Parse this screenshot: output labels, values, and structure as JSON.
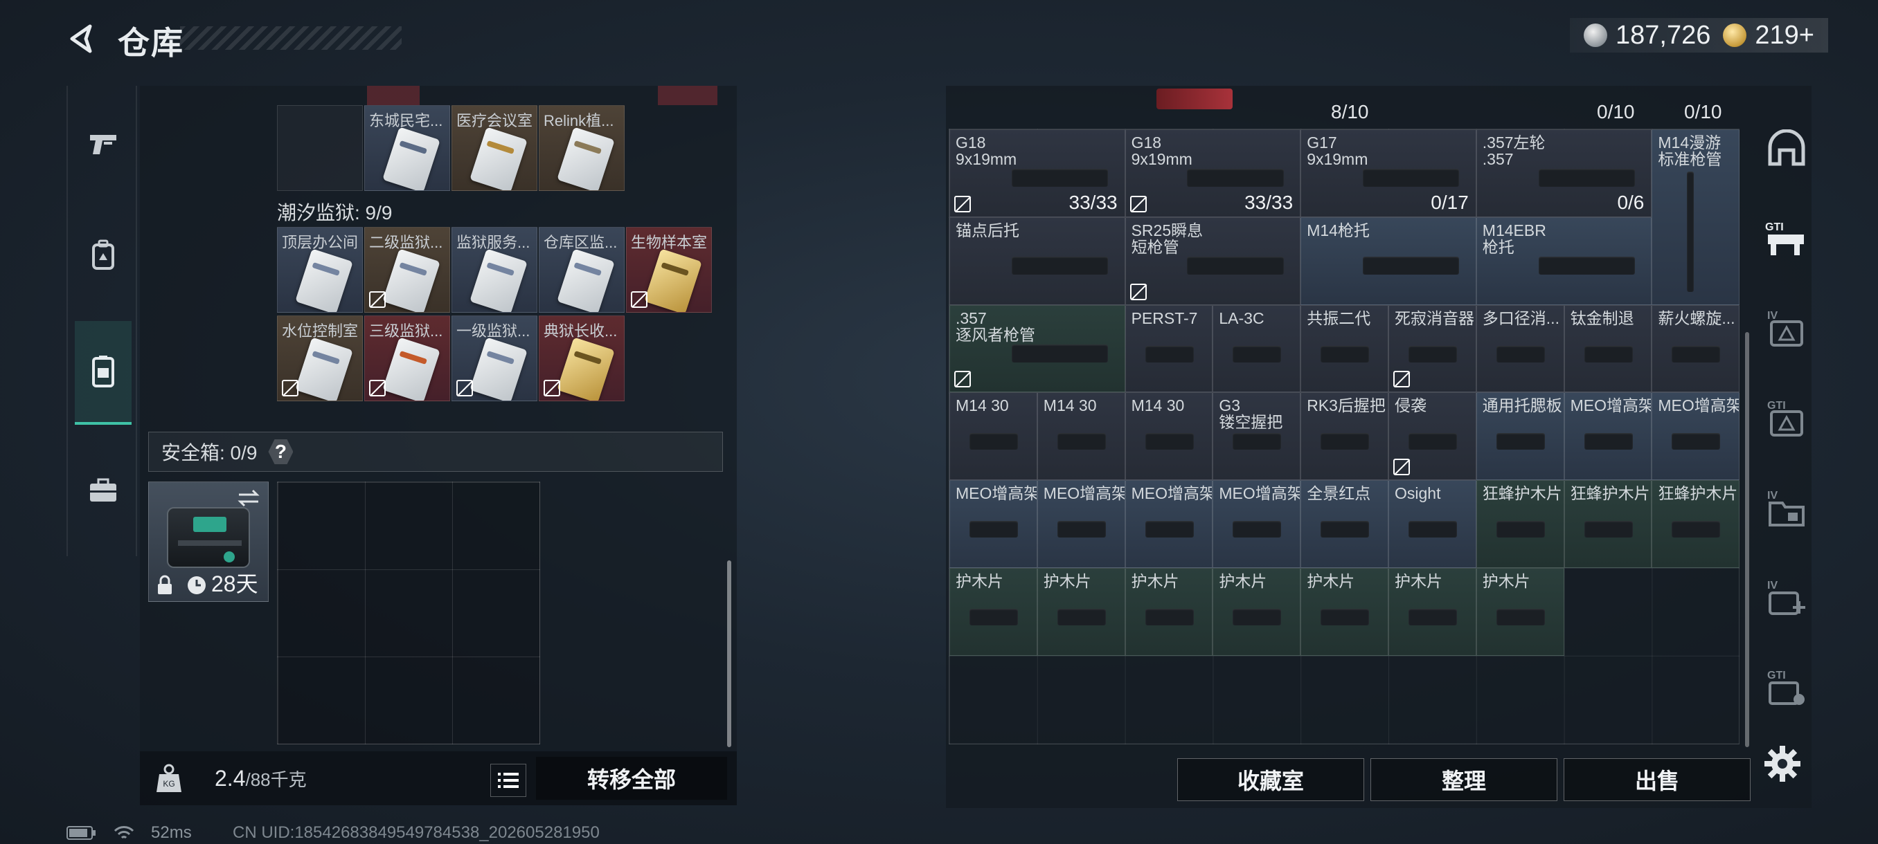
{
  "header": {
    "title": "仓库",
    "currency": [
      {
        "icon": "silver-coin-icon",
        "value": "187,726"
      },
      {
        "icon": "gold-coin-icon",
        "value": "219+"
      }
    ]
  },
  "left_nav": [
    {
      "icon": "gun-icon"
    },
    {
      "icon": "backpack-icon"
    },
    {
      "icon": "storage-locker-icon",
      "active": true
    },
    {
      "icon": "toolbox-icon"
    }
  ],
  "left_panel": {
    "cards_top_row": [
      {
        "label": "",
        "color": "dark"
      },
      {
        "label": "东城民宅...",
        "color": "blue"
      },
      {
        "label": "医疗会议室",
        "color": "brown"
      },
      {
        "label": "Relink植...",
        "color": "brown"
      }
    ],
    "prison_header": "潮汐监狱: 9/9",
    "prison_cards": [
      {
        "label": "顶层办公间",
        "color": "blue",
        "gold": false,
        "nodrop": false
      },
      {
        "label": "二级监狱...",
        "color": "brown",
        "gold": false,
        "nodrop": true
      },
      {
        "label": "监狱服务...",
        "color": "blue",
        "gold": false,
        "nodrop": false
      },
      {
        "label": "仓库区监...",
        "color": "blue",
        "gold": false,
        "nodrop": false
      },
      {
        "label": "生物样本室",
        "color": "red",
        "gold": true,
        "nodrop": true
      },
      {
        "label": "水位控制室",
        "color": "brown",
        "gold": false,
        "nodrop": true
      },
      {
        "label": "三级监狱...",
        "color": "red",
        "gold": false,
        "nodrop": true
      },
      {
        "label": "一级监狱...",
        "color": "blue",
        "gold": false,
        "nodrop": true
      },
      {
        "label": "典狱长收...",
        "color": "red",
        "gold": true,
        "nodrop": true
      }
    ],
    "safebox_label": "安全箱: 0/9",
    "safebox_help": "?",
    "safebox_item_time": "28天",
    "weight_value": "2.4",
    "weight_max": "/88千克",
    "transfer_all": "转移全部"
  },
  "right_panel": {
    "top_counts": [
      "8/10",
      "0/10",
      "0/10"
    ],
    "items": [
      {
        "name": "G18\n9x19mm",
        "count": "33/33",
        "color": "rd",
        "col": 0,
        "row": 0,
        "w": 2,
        "nodrop": true
      },
      {
        "name": "G18\n9x19mm",
        "count": "33/33",
        "color": "rd",
        "col": 2,
        "row": 0,
        "w": 2,
        "nodrop": true
      },
      {
        "name": "G17\n9x19mm",
        "count": "0/17",
        "color": "rd",
        "col": 4,
        "row": 0,
        "w": 2,
        "nodrop": false
      },
      {
        "name": ".357左轮\n.357",
        "count": "0/6",
        "color": "rd",
        "col": 6,
        "row": 0,
        "w": 2,
        "nodrop": false
      },
      {
        "name": "M14漫游\n标准枪管",
        "count": "",
        "color": "rb",
        "col": 8,
        "row": 0,
        "w": 1,
        "h": 2,
        "nodrop": false
      },
      {
        "name": "锚点后托",
        "count": "",
        "color": "rd",
        "col": 0,
        "row": 1,
        "w": 2,
        "nodrop": false
      },
      {
        "name": "SR25瞬息\n短枪管",
        "count": "",
        "color": "rd",
        "col": 2,
        "row": 1,
        "w": 2,
        "nodrop": true
      },
      {
        "name": "M14枪托",
        "count": "",
        "color": "rb",
        "col": 4,
        "row": 1,
        "w": 2,
        "nodrop": false
      },
      {
        "name": "M14EBR\n枪托",
        "count": "",
        "color": "rb",
        "col": 6,
        "row": 1,
        "w": 2,
        "nodrop": false
      },
      {
        "name": ".357\n逐风者枪管",
        "count": "",
        "color": "rg",
        "col": 0,
        "row": 2,
        "w": 2,
        "nodrop": true
      },
      {
        "name": "PERST-7",
        "count": "",
        "color": "rd",
        "col": 2,
        "row": 2,
        "w": 1,
        "nodrop": false
      },
      {
        "name": "LA-3C",
        "count": "",
        "color": "rd",
        "col": 3,
        "row": 2,
        "w": 1,
        "nodrop": false
      },
      {
        "name": "共振二代",
        "count": "",
        "color": "rd",
        "col": 4,
        "row": 2,
        "w": 1,
        "nodrop": false
      },
      {
        "name": "死寂消音器",
        "count": "",
        "color": "rd",
        "col": 5,
        "row": 2,
        "w": 1,
        "nodrop": true
      },
      {
        "name": "多口径消...",
        "count": "",
        "color": "rd",
        "col": 6,
        "row": 2,
        "w": 1,
        "nodrop": false
      },
      {
        "name": "钛金制退",
        "count": "",
        "color": "rd",
        "col": 7,
        "row": 2,
        "w": 1,
        "nodrop": false
      },
      {
        "name": "薪火螺旋...",
        "count": "",
        "color": "rd",
        "col": 8,
        "row": 2,
        "w": 1,
        "nodrop": false
      },
      {
        "name": "M14 30",
        "count": "",
        "color": "rd",
        "col": 0,
        "row": 3,
        "w": 1,
        "nodrop": false
      },
      {
        "name": "M14 30",
        "count": "",
        "color": "rd",
        "col": 1,
        "row": 3,
        "w": 1,
        "nodrop": false
      },
      {
        "name": "M14 30",
        "count": "",
        "color": "rd",
        "col": 2,
        "row": 3,
        "w": 1,
        "nodrop": false
      },
      {
        "name": "G3\n镂空握把",
        "count": "",
        "color": "rd",
        "col": 3,
        "row": 3,
        "w": 1,
        "nodrop": false
      },
      {
        "name": "RK3后握把",
        "count": "",
        "color": "rd",
        "col": 4,
        "row": 3,
        "w": 1,
        "nodrop": false
      },
      {
        "name": "侵袭",
        "count": "",
        "color": "rd",
        "col": 5,
        "row": 3,
        "w": 1,
        "nodrop": true
      },
      {
        "name": "通用托腮板",
        "count": "",
        "color": "rb",
        "col": 6,
        "row": 3,
        "w": 1,
        "nodrop": false
      },
      {
        "name": "MEO增高架",
        "count": "",
        "color": "rb",
        "col": 7,
        "row": 3,
        "w": 1,
        "nodrop": false
      },
      {
        "name": "MEO增高架",
        "count": "",
        "color": "rb",
        "col": 8,
        "row": 3,
        "w": 1,
        "nodrop": false
      },
      {
        "name": "MEO增高架",
        "count": "",
        "color": "rb",
        "col": 0,
        "row": 4,
        "w": 1,
        "nodrop": false
      },
      {
        "name": "MEO增高架",
        "count": "",
        "color": "rb",
        "col": 1,
        "row": 4,
        "w": 1,
        "nodrop": false
      },
      {
        "name": "MEO增高架",
        "count": "",
        "color": "rb",
        "col": 2,
        "row": 4,
        "w": 1,
        "nodrop": false
      },
      {
        "name": "MEO增高架",
        "count": "",
        "color": "rb",
        "col": 3,
        "row": 4,
        "w": 1,
        "nodrop": false
      },
      {
        "name": "全景红点",
        "count": "",
        "color": "rb",
        "col": 4,
        "row": 4,
        "w": 1,
        "nodrop": false
      },
      {
        "name": "Osight",
        "count": "",
        "color": "rb",
        "col": 5,
        "row": 4,
        "w": 1,
        "nodrop": false
      },
      {
        "name": "狂蜂护木片",
        "count": "",
        "color": "rg",
        "col": 6,
        "row": 4,
        "w": 1,
        "nodrop": false
      },
      {
        "name": "狂蜂护木片",
        "count": "",
        "color": "rg",
        "col": 7,
        "row": 4,
        "w": 1,
        "nodrop": false
      },
      {
        "name": "狂蜂护木片",
        "count": "",
        "color": "rg",
        "col": 8,
        "row": 4,
        "w": 1,
        "nodrop": false
      },
      {
        "name": "护木片",
        "count": "",
        "color": "rg",
        "col": 0,
        "row": 5,
        "w": 1,
        "nodrop": false
      },
      {
        "name": "护木片",
        "count": "",
        "color": "rg",
        "col": 1,
        "row": 5,
        "w": 1,
        "nodrop": false
      },
      {
        "name": "护木片",
        "count": "",
        "color": "rg",
        "col": 2,
        "row": 5,
        "w": 1,
        "nodrop": false
      },
      {
        "name": "护木片",
        "count": "",
        "color": "rg",
        "col": 3,
        "row": 5,
        "w": 1,
        "nodrop": false
      },
      {
        "name": "护木片",
        "count": "",
        "color": "rg",
        "col": 4,
        "row": 5,
        "w": 1,
        "nodrop": false
      },
      {
        "name": "护木片",
        "count": "",
        "color": "rg",
        "col": 5,
        "row": 5,
        "w": 1,
        "nodrop": false
      },
      {
        "name": "护木片",
        "count": "",
        "color": "rg",
        "col": 6,
        "row": 5,
        "w": 1,
        "nodrop": false
      }
    ],
    "buttons": {
      "collection": "收藏室",
      "organize": "整理",
      "sell": "出售"
    }
  },
  "right_nav": [
    {
      "icon": "shelter-icon"
    },
    {
      "icon": "gti-workbench-icon"
    },
    {
      "icon": "iv-triangle-icon"
    },
    {
      "icon": "gti-triangle-icon"
    },
    {
      "icon": "iv-folder-icon"
    },
    {
      "icon": "iv-medkit-icon"
    },
    {
      "icon": "gti-box-icon"
    }
  ],
  "status": {
    "ping": "52ms",
    "uid": "CN UID:18542683849549784538_202605281950"
  }
}
